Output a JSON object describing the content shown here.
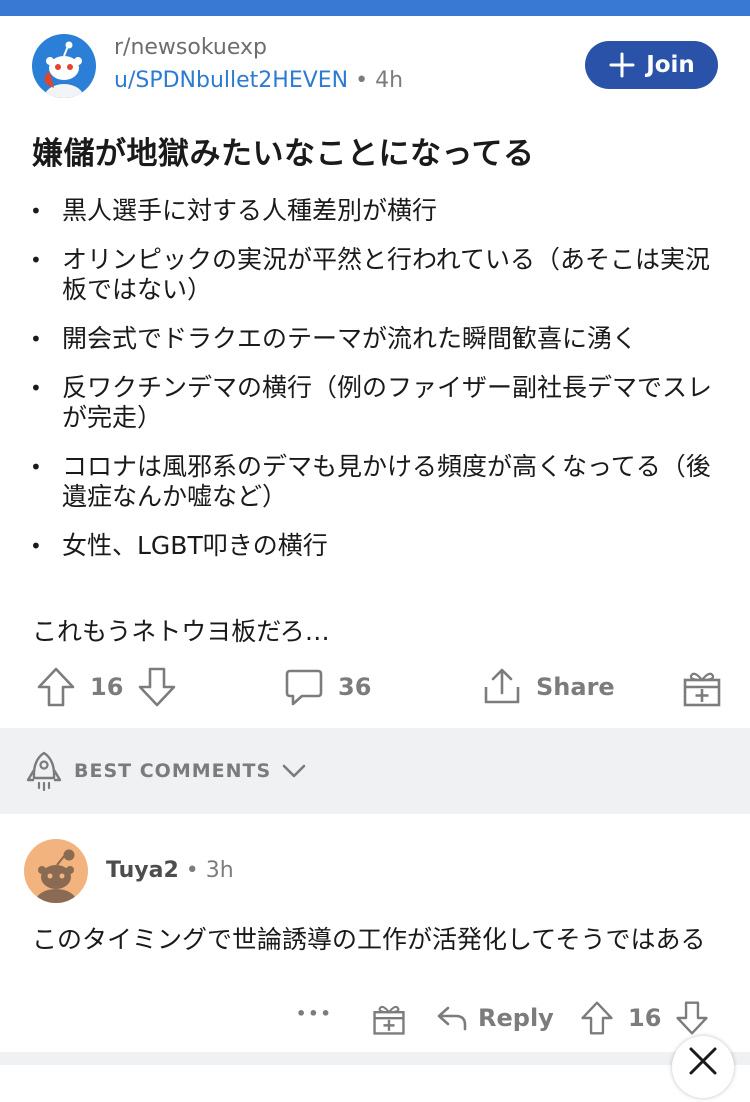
{
  "post": {
    "subreddit": "r/newsokuexp",
    "author": "u/SPDNbullet2HEVEN",
    "separator": "•",
    "age": "4h",
    "join_label": "Join",
    "title": "嫌儲が地獄みたいなことになってる",
    "bullets": [
      "黒人選手に対する人種差別が横行",
      "オリンピックの実況が平然と行われている（あそこは実況板ではない）",
      "開会式でドラクエのテーマが流れた瞬間歓喜に湧く",
      "反ワクチンデマの横行（例のファイザー副社長デマでスレが完走）",
      "コロナは風邪系のデマも見かける頻度が高くなってる（後遺症なんか嘘など）",
      "女性、LGBT叩きの横行"
    ],
    "closing": "これもうネトウヨ板だろ…",
    "votes": "16",
    "comments": "36",
    "share_label": "Share"
  },
  "section": {
    "sort_label": "BEST COMMENTS"
  },
  "comment": {
    "author": "Tuya2",
    "separator": "•",
    "age": "3h",
    "body": "このタイミングで世論誘導の工作が活発化してそうではある",
    "more": "•••",
    "reply_label": "Reply",
    "votes": "16"
  },
  "colors": {
    "accent_blue": "#3a79d3",
    "join_button": "#2a52a8",
    "username_link": "#2d7bd0",
    "muted_text": "#7c7c7c",
    "band_gray": "#f0f1f3"
  },
  "icons": {
    "subreddit_avatar": "snoo-avatar-blue",
    "commenter_avatar": "snoo-avatar-tan",
    "join": "plus-icon",
    "upvote": "arrow-up-icon",
    "downvote": "arrow-down-icon",
    "comments": "speech-bubble-icon",
    "share": "share-icon",
    "award": "gift-icon",
    "sort": "rocket-icon",
    "dropdown": "chevron-down-icon",
    "reply": "reply-arrow-icon",
    "collapse": "close-icon"
  }
}
